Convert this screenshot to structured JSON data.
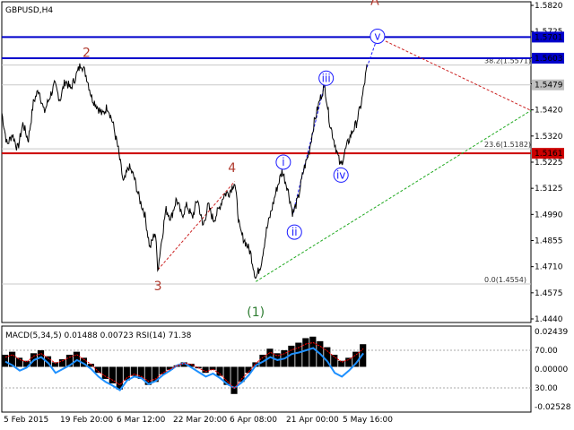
{
  "chart_title": "GBPUSD,H4",
  "colors": {
    "price": "#000000",
    "blue_line": "#0000cc",
    "red_line": "#cc0000",
    "fib_line": "#c8c8c8",
    "wave_red": "#b03a2e",
    "wave_green": "#2e7d32",
    "wave_blue": "#1a1aff",
    "tri_red": "#cc2222",
    "tri_green": "#22aa22",
    "macd_hist": "#000000",
    "macd_signal": "#ff0000",
    "rsi": "#1e90ff",
    "label_bg": "#0000cc",
    "label_bg_red": "#cc0000",
    "label_bg_grey": "#c0c0c0"
  },
  "chart_data": [
    {
      "type": "candlestick-line",
      "title": "GBPUSD,H4",
      "ylim": [
        1.4375,
        1.5865
      ],
      "y_ticks": [
        "1.5820",
        "1.5725",
        "1.5625",
        "1.5525",
        "1.5420",
        "1.5320",
        "1.5225",
        "1.5125",
        "1.4990",
        "1.4855",
        "1.4710",
        "1.4575",
        "1.4440"
      ],
      "x_ticks": [
        "5 Feb 2015",
        "19 Feb 20:00",
        "6 Mar 12:00",
        "22 Mar 20:00",
        "6 Apr 08:00",
        "21 Apr 00:00",
        "5 May 16:00"
      ],
      "horizontal_levels": [
        {
          "name": "1.5701",
          "value": 1.5701,
          "color_key": "blue_line",
          "label_color_key": "label_bg"
        },
        {
          "name": "1.5603",
          "value": 1.5603,
          "color_key": "blue_line",
          "label_color_key": "label_bg"
        },
        {
          "name": "1.5479",
          "value": 1.5479,
          "color_key": "fib_line",
          "label_color_key": "label_bg_grey"
        },
        {
          "name": "1.5161",
          "value": 1.5161,
          "color_key": "red_line",
          "label_color_key": "label_bg_red"
        }
      ],
      "fib_levels": [
        {
          "label": "38.2(1.5571)",
          "value": 1.5571
        },
        {
          "label": "23.6(1.5182)",
          "value": 1.5182
        },
        {
          "label": "0.0(1.4554)",
          "value": 1.4554
        }
      ],
      "wave_labels": [
        {
          "text": "2",
          "style": "red",
          "x": 0.16,
          "price": 1.561
        },
        {
          "text": "3",
          "style": "red",
          "x": 0.295,
          "price": 1.4525
        },
        {
          "text": "4",
          "style": "red",
          "x": 0.435,
          "price": 1.5075
        },
        {
          "text": "A",
          "style": "red",
          "x": 0.705,
          "price": 1.585
        },
        {
          "text": "(1)",
          "style": "green",
          "x": 0.48,
          "price": 1.4405
        },
        {
          "text": "i",
          "style": "blue",
          "x": 0.532,
          "price": 1.512
        },
        {
          "text": "ii",
          "style": "blue",
          "x": 0.553,
          "price": 1.4795
        },
        {
          "text": "iii",
          "style": "blue",
          "x": 0.613,
          "price": 1.551
        },
        {
          "text": "iv",
          "style": "blue",
          "x": 0.641,
          "price": 1.506
        },
        {
          "text": "v",
          "style": "blue",
          "x": 0.71,
          "price": 1.5705
        }
      ],
      "price_path": [
        [
          0.0,
          1.535
        ],
        [
          0.01,
          1.52
        ],
        [
          0.02,
          1.525
        ],
        [
          0.03,
          1.518
        ],
        [
          0.04,
          1.53
        ],
        [
          0.05,
          1.522
        ],
        [
          0.06,
          1.54
        ],
        [
          0.07,
          1.546
        ],
        [
          0.08,
          1.535
        ],
        [
          0.09,
          1.542
        ],
        [
          0.1,
          1.548
        ],
        [
          0.11,
          1.541
        ],
        [
          0.12,
          1.55
        ],
        [
          0.13,
          1.546
        ],
        [
          0.14,
          1.552
        ],
        [
          0.15,
          1.558
        ],
        [
          0.16,
          1.552
        ],
        [
          0.17,
          1.542
        ],
        [
          0.18,
          1.538
        ],
        [
          0.19,
          1.534
        ],
        [
          0.2,
          1.538
        ],
        [
          0.21,
          1.53
        ],
        [
          0.22,
          1.518
        ],
        [
          0.23,
          1.502
        ],
        [
          0.24,
          1.51
        ],
        [
          0.25,
          1.505
        ],
        [
          0.26,
          1.495
        ],
        [
          0.27,
          1.488
        ],
        [
          0.28,
          1.472
        ],
        [
          0.29,
          1.48
        ],
        [
          0.295,
          1.462
        ],
        [
          0.3,
          1.472
        ],
        [
          0.31,
          1.49
        ],
        [
          0.32,
          1.486
        ],
        [
          0.33,
          1.495
        ],
        [
          0.34,
          1.487
        ],
        [
          0.35,
          1.492
        ],
        [
          0.36,
          1.486
        ],
        [
          0.37,
          1.495
        ],
        [
          0.38,
          1.482
        ],
        [
          0.39,
          1.492
        ],
        [
          0.4,
          1.485
        ],
        [
          0.41,
          1.49
        ],
        [
          0.42,
          1.497
        ],
        [
          0.43,
          1.498
        ],
        [
          0.44,
          1.503
        ],
        [
          0.45,
          1.48
        ],
        [
          0.46,
          1.475
        ],
        [
          0.47,
          1.47
        ],
        [
          0.48,
          1.458
        ],
        [
          0.49,
          1.465
        ],
        [
          0.5,
          1.48
        ],
        [
          0.51,
          1.49
        ],
        [
          0.52,
          1.5
        ],
        [
          0.53,
          1.508
        ],
        [
          0.54,
          1.5
        ],
        [
          0.55,
          1.488
        ],
        [
          0.56,
          1.495
        ],
        [
          0.57,
          1.508
        ],
        [
          0.58,
          1.516
        ],
        [
          0.59,
          1.53
        ],
        [
          0.6,
          1.54
        ],
        [
          0.61,
          1.548
        ],
        [
          0.62,
          1.53
        ],
        [
          0.63,
          1.52
        ],
        [
          0.64,
          1.51
        ],
        [
          0.65,
          1.518
        ],
        [
          0.66,
          1.525
        ],
        [
          0.67,
          1.53
        ],
        [
          0.68,
          1.54
        ],
        [
          0.69,
          1.556
        ]
      ]
    },
    {
      "type": "line",
      "title": "MACD(5,34,5) 0.01488 0.00723 RSI(14) 71.38",
      "ylim": [
        -0.03,
        0.027
      ],
      "y_ticks": [
        "0.02439",
        "70.00",
        "0.00000",
        "30.00",
        "-0.02528"
      ],
      "series": [
        {
          "name": "MACD",
          "values": [
            0.008,
            0.01,
            0.006,
            0.004,
            0.009,
            0.011,
            0.007,
            0.003,
            0.005,
            0.008,
            0.01,
            0.006,
            0.002,
            -0.004,
            -0.008,
            -0.011,
            -0.015,
            -0.009,
            -0.006,
            -0.008,
            -0.012,
            -0.01,
            -0.005,
            -0.002,
            0.001,
            0.003,
            0.002,
            -0.001,
            -0.004,
            -0.002,
            -0.006,
            -0.012,
            -0.018,
            -0.01,
            -0.004,
            0.003,
            0.008,
            0.012,
            0.009,
            0.011,
            0.014,
            0.016,
            0.019,
            0.02,
            0.017,
            0.013,
            0.008,
            0.004,
            0.006,
            0.01,
            0.015
          ]
        },
        {
          "name": "RSI",
          "values": [
            60,
            55,
            48,
            52,
            62,
            66,
            58,
            45,
            50,
            55,
            62,
            57,
            50,
            40,
            33,
            28,
            22,
            35,
            40,
            38,
            30,
            34,
            42,
            48,
            55,
            58,
            52,
            46,
            40,
            44,
            38,
            30,
            25,
            32,
            42,
            55,
            60,
            66,
            62,
            64,
            70,
            72,
            75,
            78,
            70,
            60,
            45,
            40,
            48,
            58,
            71
          ]
        }
      ]
    }
  ]
}
